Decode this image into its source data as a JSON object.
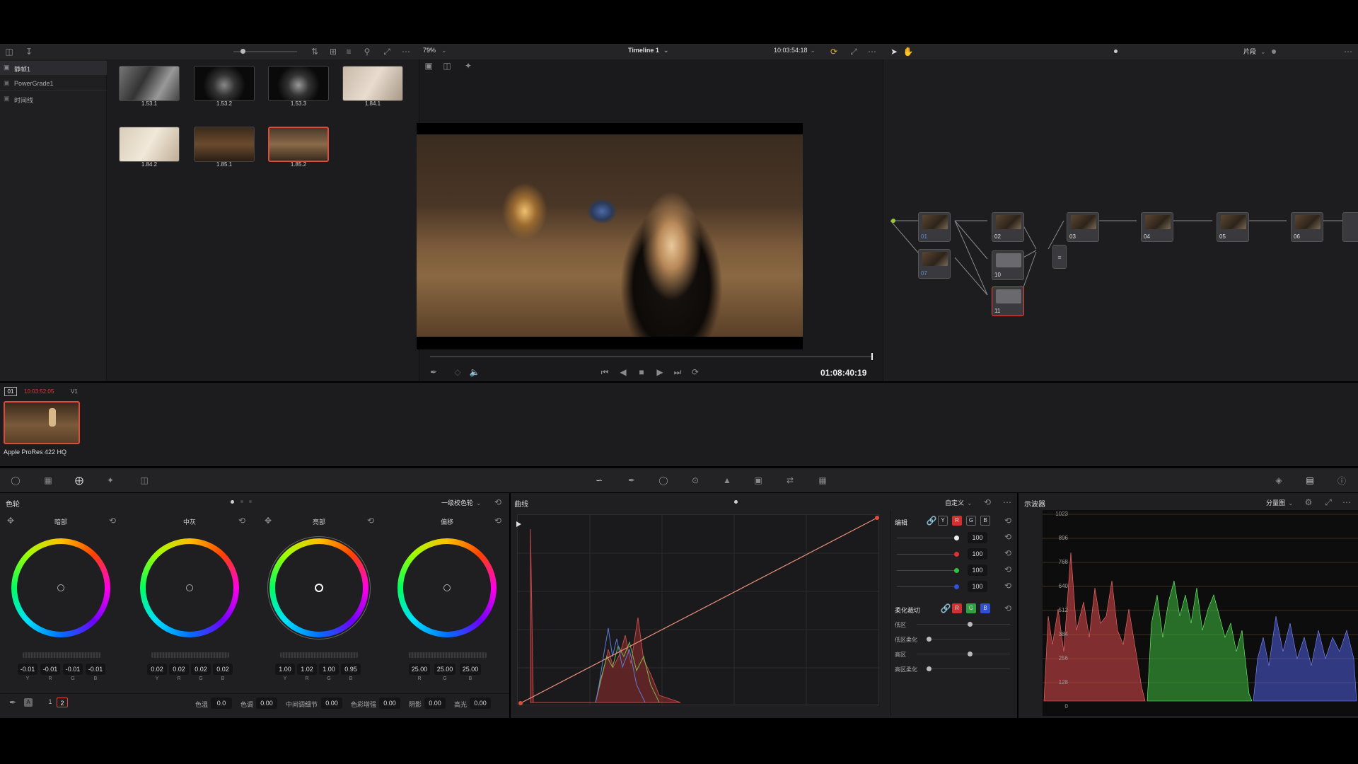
{
  "gallery": {
    "sidebar": [
      {
        "label": "静帧1"
      },
      {
        "label": "PowerGrade1"
      },
      {
        "label": "时间线"
      }
    ],
    "stills": [
      "1.53.1",
      "1.53.2",
      "1.53.3",
      "1.84.1",
      "1.84.2",
      "1.85.1",
      "1.85.2"
    ]
  },
  "viewer": {
    "zoom": "79%",
    "timeline_name": "Timeline 1",
    "timecode_top": "10:03:54:18",
    "timecode_bottom": "01:08:40:19"
  },
  "nodes_header": {
    "mode": "片段"
  },
  "nodes": [
    "01",
    "02",
    "03",
    "04",
    "05",
    "06",
    "07",
    "10",
    "11"
  ],
  "clip_strip": {
    "clip_number": "01",
    "clip_timecode": "10:03:52:05",
    "track": "V1",
    "codec": "Apple ProRes 422 HQ"
  },
  "wheels_panel": {
    "title": "色轮",
    "mode": "一级校色轮",
    "wheels": [
      {
        "name": "暗部",
        "values": [
          "-0.01",
          "-0.01",
          "-0.01",
          "-0.01"
        ]
      },
      {
        "name": "中灰",
        "values": [
          "0.02",
          "0.02",
          "0.02",
          "0.02"
        ]
      },
      {
        "name": "亮部",
        "values": [
          "1.00",
          "1.02",
          "1.00",
          "0.95"
        ]
      },
      {
        "name": "偏移",
        "values": [
          "25.00",
          "25.00",
          "25.00"
        ]
      }
    ],
    "channel_labels": [
      "Y",
      "R",
      "G",
      "B"
    ],
    "page_1": "1",
    "page_2": "2",
    "bottom_params": [
      {
        "label": "色温",
        "value": "0.0"
      },
      {
        "label": "色调",
        "value": "0.00"
      },
      {
        "label": "中间调细节",
        "value": "0.00"
      },
      {
        "label": "色彩增强",
        "value": "0.00"
      },
      {
        "label": "阴影",
        "value": "0.00"
      },
      {
        "label": "高光",
        "value": "0.00"
      }
    ]
  },
  "curves_panel": {
    "title": "曲线",
    "mode": "自定义",
    "edit_label": "编辑",
    "channels": [
      "Y",
      "R",
      "G",
      "B"
    ],
    "intensity": [
      "100",
      "100",
      "100",
      "100"
    ],
    "soft_clip_label": "柔化裁切",
    "soft_clip_rows": [
      "低区",
      "低区柔化",
      "高区",
      "高区柔化"
    ]
  },
  "scope_panel": {
    "title": "示波器",
    "mode": "分量图",
    "y_ticks": [
      "1023",
      "896",
      "768",
      "640",
      "512",
      "384",
      "256",
      "128",
      "0"
    ]
  },
  "colors": {
    "accent_red": "#e04a3a",
    "timecode_red": "#e0392b",
    "bg_panel": "#1f1f22",
    "bg_bar": "#28282b"
  }
}
